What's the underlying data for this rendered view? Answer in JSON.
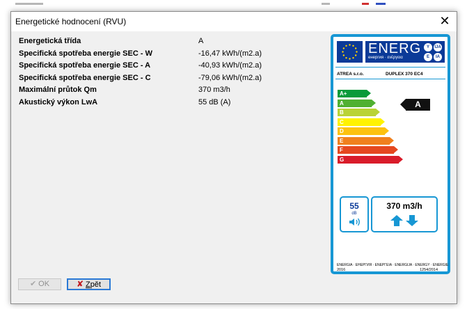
{
  "window": {
    "title": "Energetické hodnocení (RVU)",
    "close_glyph": "✕"
  },
  "properties": [
    {
      "name": "Energetická třída",
      "value": "A"
    },
    {
      "name": "Specifická spotřeba energie SEC - W",
      "value": "-16,47 kWh/(m2.a)"
    },
    {
      "name": "Specifická spotřeba energie SEC - A",
      "value": "-40,93 kWh/(m2.a)"
    },
    {
      "name": "Specifická spotřeba energie SEC - C",
      "value": "-79,06 kWh/(m2.a)"
    },
    {
      "name": "Maximální průtok Qm",
      "value": "370 m3/h"
    },
    {
      "name": "Akustický výkon LwA",
      "value": "55 dB (A)"
    }
  ],
  "energy_label": {
    "header": "ENERG",
    "header_sub": "енергия · ενέργεια",
    "lang_marks": [
      "Y",
      "IJA",
      "E",
      "IA"
    ],
    "manufacturer": "ATREA s.r.o.",
    "model": "DUPLEX 370 EC4",
    "classes": [
      {
        "label": "A+",
        "color": "#0a9a3a"
      },
      {
        "label": "A",
        "color": "#50b031"
      },
      {
        "label": "B",
        "color": "#b9d336"
      },
      {
        "label": "C",
        "color": "#fff200"
      },
      {
        "label": "D",
        "color": "#fdc20f"
      },
      {
        "label": "E",
        "color": "#f0801d"
      },
      {
        "label": "F",
        "color": "#e5481f"
      },
      {
        "label": "G",
        "color": "#d91c2a"
      }
    ],
    "rating": "A",
    "noise_value": "55",
    "noise_unit": "dB",
    "flow": "370 m3/h",
    "footer_code": "ENERGIA · ЕНЕРГИЯ · ΕΝΕΡΓΕΙΑ · ENERGIJA · ENERGY · ENERGIE",
    "footer_left": "2016",
    "footer_right": "1254/2014",
    "colors": {
      "border": "#1797d4",
      "header": "#0b3a98"
    }
  },
  "buttons": {
    "ok_label": "OK",
    "back_label_pre": "",
    "back_label_underline": "Z",
    "back_label_post": "pět"
  }
}
